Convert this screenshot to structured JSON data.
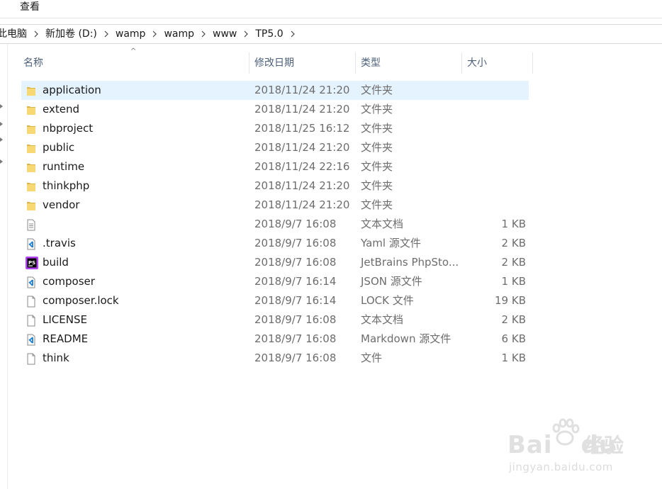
{
  "menubar": {
    "view": "查看"
  },
  "breadcrumb": [
    {
      "label": "此电脑"
    },
    {
      "label": "新加卷 (D:)"
    },
    {
      "label": "wamp"
    },
    {
      "label": "wamp"
    },
    {
      "label": "www"
    },
    {
      "label": "TP5.0"
    }
  ],
  "columns": {
    "name": "名称",
    "date": "修改日期",
    "type": "类型",
    "size": "大小"
  },
  "files": [
    {
      "name": "application",
      "date": "2018/11/24 21:20",
      "type": "文件夹",
      "size": "",
      "icon": "folder-icon",
      "selected": true
    },
    {
      "name": "extend",
      "date": "2018/11/24 21:20",
      "type": "文件夹",
      "size": "",
      "icon": "folder-icon"
    },
    {
      "name": "nbproject",
      "date": "2018/11/25 16:12",
      "type": "文件夹",
      "size": "",
      "icon": "folder-icon"
    },
    {
      "name": "public",
      "date": "2018/11/24 21:20",
      "type": "文件夹",
      "size": "",
      "icon": "folder-icon"
    },
    {
      "name": "runtime",
      "date": "2018/11/24 22:16",
      "type": "文件夹",
      "size": "",
      "icon": "folder-icon"
    },
    {
      "name": "thinkphp",
      "date": "2018/11/24 21:20",
      "type": "文件夹",
      "size": "",
      "icon": "folder-icon"
    },
    {
      "name": "vendor",
      "date": "2018/11/24 21:20",
      "type": "文件夹",
      "size": "",
      "icon": "folder-icon"
    },
    {
      "name": "",
      "date": "2018/9/7 16:08",
      "type": "文本文档",
      "size": "1 KB",
      "icon": "text-file-icon"
    },
    {
      "name": ".travis",
      "date": "2018/9/7 16:08",
      "type": "Yaml 源文件",
      "size": "2 KB",
      "icon": "vscode-file-icon"
    },
    {
      "name": "build",
      "date": "2018/9/7 16:08",
      "type": "JetBrains PhpSto...",
      "size": "2 KB",
      "icon": "phpstorm-file-icon"
    },
    {
      "name": "composer",
      "date": "2018/9/7 16:14",
      "type": "JSON 源文件",
      "size": "1 KB",
      "icon": "vscode-file-icon"
    },
    {
      "name": "composer.lock",
      "date": "2018/9/7 16:14",
      "type": "LOCK 文件",
      "size": "19 KB",
      "icon": "blank-file-icon"
    },
    {
      "name": "LICENSE",
      "date": "2018/9/7 16:08",
      "type": "文本文档",
      "size": "2 KB",
      "icon": "blank-file-icon"
    },
    {
      "name": "README",
      "date": "2018/9/7 16:08",
      "type": "Markdown 源文件",
      "size": "6 KB",
      "icon": "vscode-file-icon"
    },
    {
      "name": "think",
      "date": "2018/9/7 16:08",
      "type": "文件",
      "size": "1 KB",
      "icon": "blank-file-icon"
    }
  ],
  "watermark": {
    "brand": "Bai",
    "brand2": "du",
    "jingyan": "经验",
    "url": "jingyan.baidu.com"
  }
}
